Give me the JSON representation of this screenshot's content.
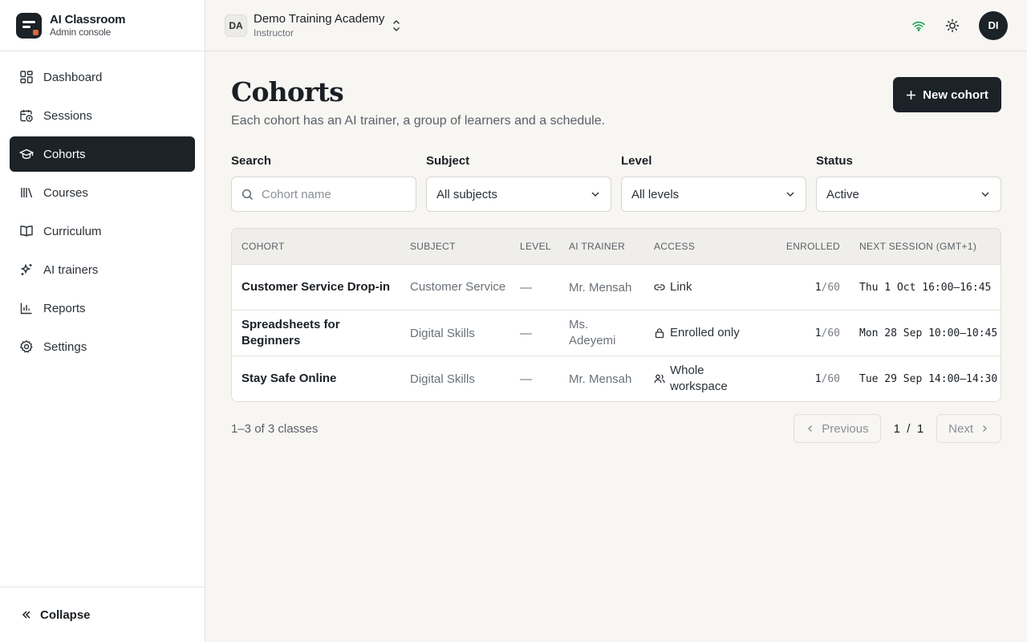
{
  "brand": {
    "title": "AI Classroom",
    "subtitle": "Admin console"
  },
  "sidebar": {
    "items": [
      {
        "label": "Dashboard",
        "icon": "dashboard-icon",
        "active": false
      },
      {
        "label": "Sessions",
        "icon": "calendar-clock-icon",
        "active": false
      },
      {
        "label": "Cohorts",
        "icon": "graduation-cap-icon",
        "active": true
      },
      {
        "label": "Courses",
        "icon": "library-icon",
        "active": false
      },
      {
        "label": "Curriculum",
        "icon": "book-open-icon",
        "active": false
      },
      {
        "label": "AI trainers",
        "icon": "sparkles-icon",
        "active": false
      },
      {
        "label": "Reports",
        "icon": "bar-chart-icon",
        "active": false
      },
      {
        "label": "Settings",
        "icon": "gear-icon",
        "active": false
      }
    ],
    "collapse_label": "Collapse"
  },
  "header": {
    "org_initials": "DA",
    "org_name": "Demo Training Academy",
    "role": "Instructor",
    "user_initials": "DI"
  },
  "page": {
    "title": "Cohorts",
    "subtitle": "Each cohort has an AI trainer, a group of learners and a schedule.",
    "new_button": "New cohort"
  },
  "filters": {
    "search": {
      "label": "Search",
      "placeholder": "Cohort name"
    },
    "subject": {
      "label": "Subject",
      "value": "All subjects"
    },
    "level": {
      "label": "Level",
      "value": "All levels"
    },
    "status": {
      "label": "Status",
      "value": "Active"
    }
  },
  "table": {
    "headers": [
      "COHORT",
      "SUBJECT",
      "LEVEL",
      "AI TRAINER",
      "ACCESS",
      "ENROLLED",
      "NEXT SESSION (GMT+1)"
    ],
    "rows": [
      {
        "cohort": "Customer Service Drop-in",
        "subject": "Customer Service",
        "level": "—",
        "trainer": "Mr. Mensah",
        "access": "Link",
        "access_icon": "link-icon",
        "enrolled": "1",
        "capacity": "/60",
        "next": "Thu 1 Oct 16:00–16:45"
      },
      {
        "cohort": "Spreadsheets for Beginners",
        "subject": "Digital Skills",
        "level": "—",
        "trainer": "Ms. Adeyemi",
        "access": "Enrolled only",
        "access_icon": "lock-icon",
        "enrolled": "1",
        "capacity": "/60",
        "next": "Mon 28 Sep 10:00–10:45"
      },
      {
        "cohort": "Stay Safe Online",
        "subject": "Digital Skills",
        "level": "—",
        "trainer": "Mr. Mensah",
        "access": "Whole workspace",
        "access_icon": "users-icon",
        "enrolled": "1",
        "capacity": "/60",
        "next": "Tue 29 Sep 14:00–14:30"
      }
    ]
  },
  "pagination": {
    "summary": "1–3 of 3 classes",
    "previous": "Previous",
    "next": "Next",
    "current": "1",
    "separator": "/",
    "total": "1"
  }
}
